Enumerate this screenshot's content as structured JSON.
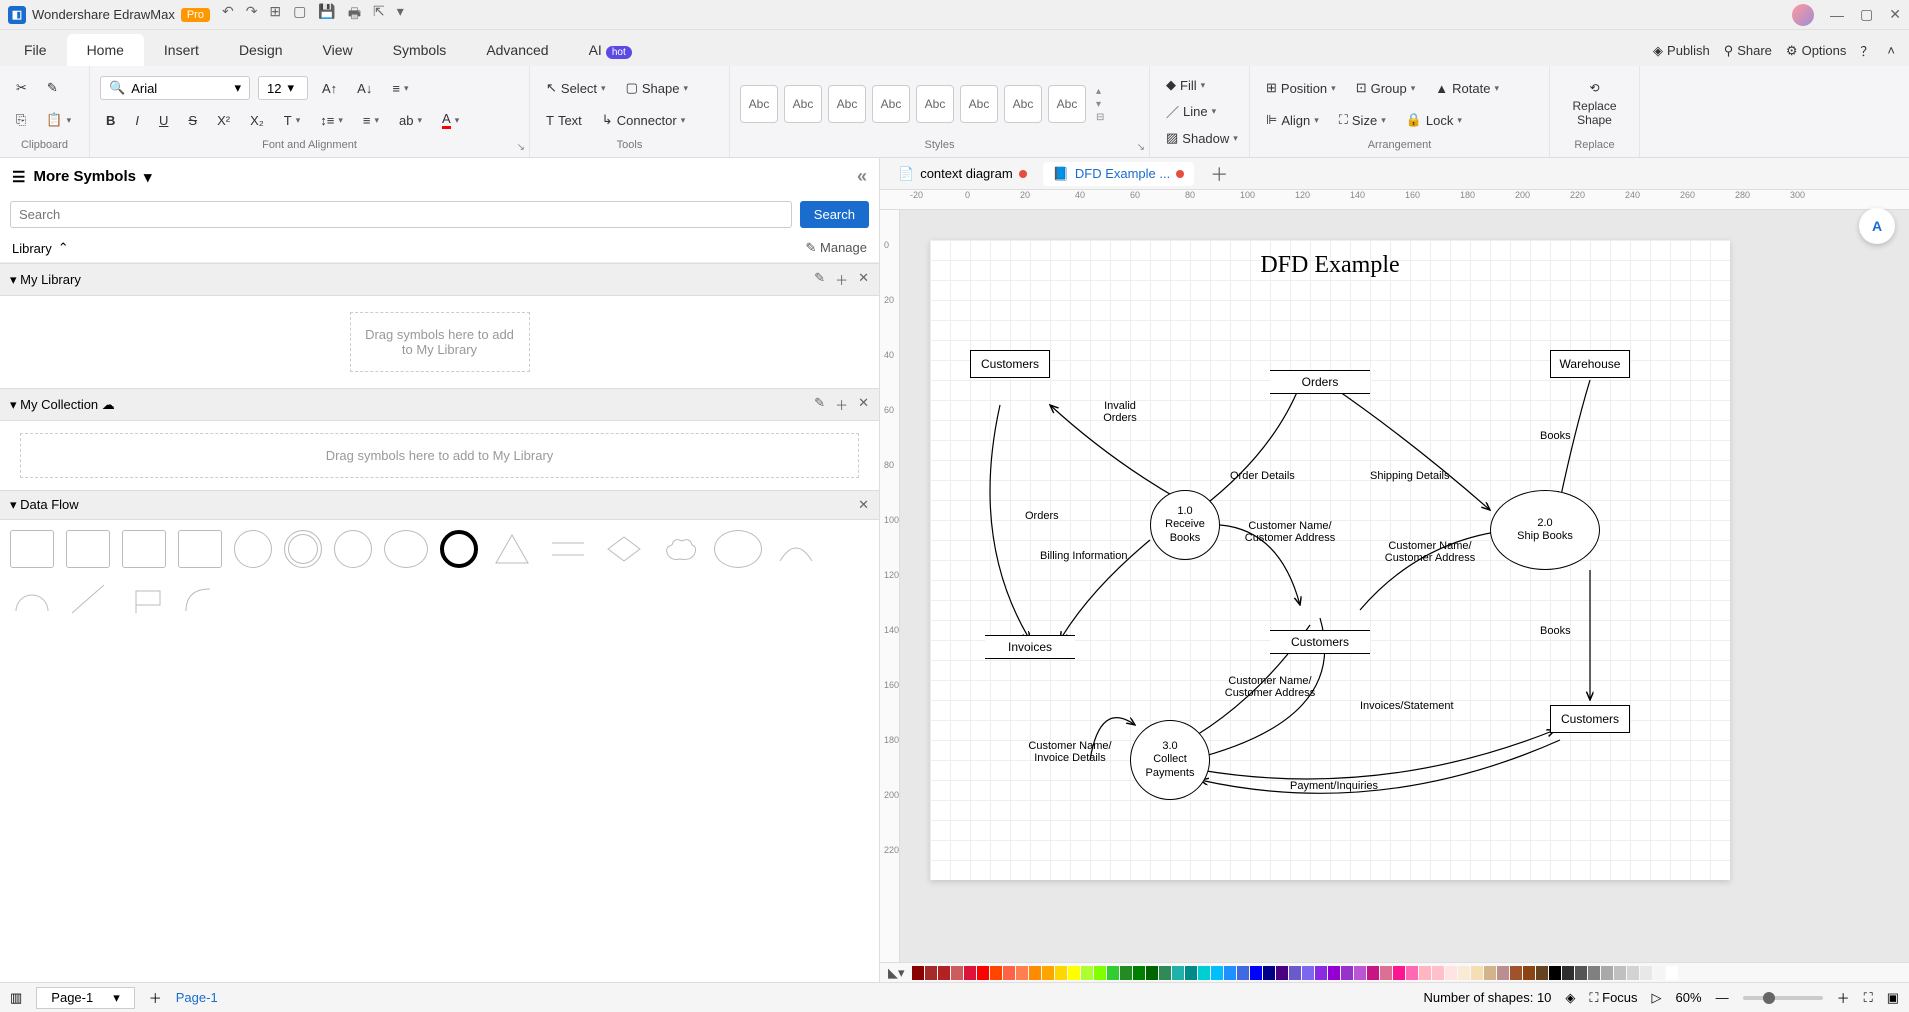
{
  "app": {
    "name": "Wondershare EdrawMax",
    "badge": "Pro"
  },
  "menu": {
    "tabs": [
      "File",
      "Home",
      "Insert",
      "Design",
      "View",
      "Symbols",
      "Advanced",
      "AI"
    ],
    "active": 1,
    "hot_label": "hot",
    "right": {
      "publish": "Publish",
      "share": "Share",
      "options": "Options"
    }
  },
  "ribbon": {
    "clipboard": {
      "label": "Clipboard"
    },
    "font": {
      "label": "Font and Alignment",
      "name": "Arial",
      "size": "12"
    },
    "tools": {
      "label": "Tools",
      "select": "Select",
      "shape": "Shape",
      "text": "Text",
      "connector": "Connector"
    },
    "styles": {
      "label": "Styles",
      "swatch": "Abc"
    },
    "format": {
      "fill": "Fill",
      "line": "Line",
      "shadow": "Shadow"
    },
    "arrangement": {
      "label": "Arrangement",
      "position": "Position",
      "group": "Group",
      "rotate": "Rotate",
      "align": "Align",
      "size": "Size",
      "lock": "Lock"
    },
    "replace": {
      "label": "Replace",
      "button": "Replace Shape"
    }
  },
  "symbols": {
    "title": "More Symbols",
    "search_placeholder": "Search",
    "search_btn": "Search",
    "library": "Library",
    "manage": "Manage",
    "sections": {
      "mylib": "My Library",
      "mycol": "My Collection",
      "dataflow": "Data Flow"
    },
    "dropzone1": "Drag symbols here to add to My Library",
    "dropzone2": "Drag symbols here to add to My Library"
  },
  "tabs": {
    "items": [
      {
        "label": "context diagram",
        "modified": true,
        "active": false
      },
      {
        "label": "DFD Example ...",
        "modified": true,
        "active": true
      }
    ]
  },
  "hruler_ticks": [
    "-20",
    "0",
    "20",
    "40",
    "60",
    "80",
    "100",
    "120",
    "140",
    "160",
    "180",
    "200",
    "220",
    "240",
    "260",
    "280",
    "300"
  ],
  "vruler_ticks": [
    "0",
    "20",
    "40",
    "60",
    "80",
    "100",
    "120",
    "140",
    "160",
    "180",
    "200",
    "220"
  ],
  "diagram": {
    "title": "DFD Example",
    "entities": {
      "customers_tl": "Customers",
      "warehouse": "Warehouse",
      "customers_br": "Customers"
    },
    "processes": {
      "p1": {
        "id": "1.0",
        "name": "Receive Books"
      },
      "p2": {
        "id": "2.0",
        "name": "Ship Books"
      },
      "p3": {
        "id": "3.0",
        "name": "Collect Payments"
      }
    },
    "stores": {
      "orders": "Orders",
      "invoices": "Invoices",
      "customers": "Customers"
    },
    "flows": {
      "invalid_orders": "Invalid Orders",
      "orders": "Orders",
      "order_details": "Order Details",
      "shipping_details": "Shipping Details",
      "books1": "Books",
      "books2": "Books",
      "cust_addr1": "Customer Name/ Customer Address",
      "cust_addr2": "Customer Name/ Customer Address",
      "cust_addr3": "Customer Name/ Customer Address",
      "billing": "Billing Information",
      "cust_invoice": "Customer Name/ Invoice Details",
      "invoices_stmt": "Invoices/Statement",
      "payment": "Payment/Inquiries"
    }
  },
  "colorbar_colors": [
    "#8b0000",
    "#a52a2a",
    "#b22222",
    "#cd5c5c",
    "#dc143c",
    "#ff0000",
    "#ff4500",
    "#ff6347",
    "#ff7f50",
    "#ff8c00",
    "#ffa500",
    "#ffd700",
    "#ffff00",
    "#adff2f",
    "#7fff00",
    "#32cd32",
    "#228b22",
    "#008000",
    "#006400",
    "#2e8b57",
    "#20b2aa",
    "#008b8b",
    "#00ced1",
    "#00bfff",
    "#1e90ff",
    "#4169e1",
    "#0000ff",
    "#00008b",
    "#4b0082",
    "#6a5acd",
    "#7b68ee",
    "#8a2be2",
    "#9400d3",
    "#9932cc",
    "#ba55d3",
    "#c71585",
    "#db7093",
    "#ff1493",
    "#ff69b4",
    "#ffb6c1",
    "#ffc0cb",
    "#ffe4e1",
    "#faebd7",
    "#f5deb3",
    "#d2b48c",
    "#bc8f8f",
    "#a0522d",
    "#8b4513",
    "#654321",
    "#000000",
    "#2f2f2f",
    "#555555",
    "#808080",
    "#a9a9a9",
    "#c0c0c0",
    "#d3d3d3",
    "#e8e8e8",
    "#f5f5f5",
    "#ffffff"
  ],
  "statusbar": {
    "page_sel": "Page-1",
    "page_link": "Page-1",
    "shapes_label": "Number of shapes:",
    "shapes_count": "10",
    "focus": "Focus",
    "zoom": "60%"
  }
}
